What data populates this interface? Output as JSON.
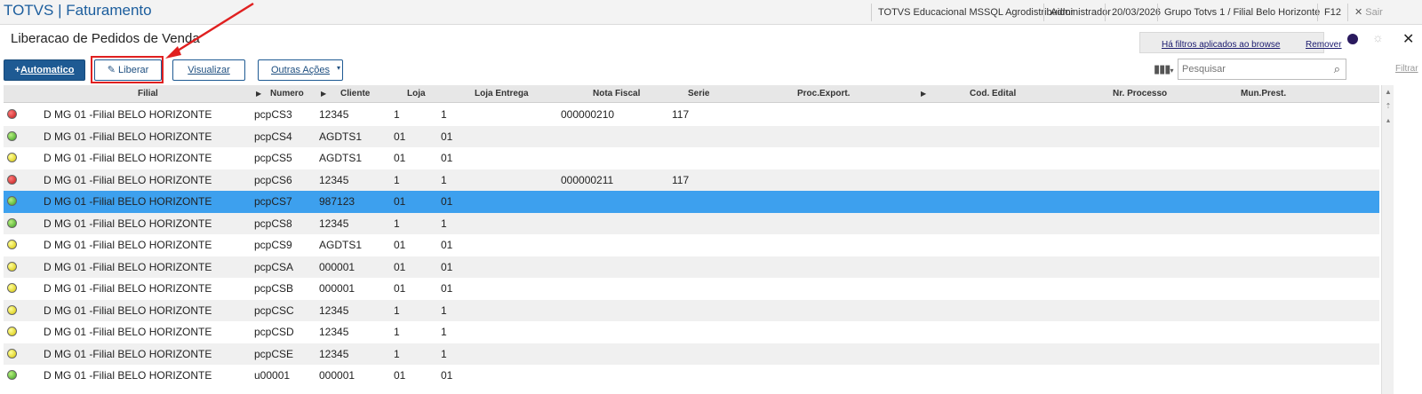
{
  "app": {
    "title": "TOTVS | Faturamento"
  },
  "topbar": {
    "environment": "TOTVS Educacional MSSQL Agrodistribuidor",
    "user": "Administrador",
    "date": "20/03/2026",
    "branch": "Grupo Totvs 1 / Filial Belo Horizonte",
    "f12": "F12",
    "exit": "Sair"
  },
  "page": {
    "title": "Liberacao de Pedidos de Venda"
  },
  "filters": {
    "applied": "Há filtros aplicados ao browse",
    "remove": "Remover"
  },
  "toolbar": {
    "automatico": "Automatico",
    "liberar": "Liberar",
    "visualizar": "Visualizar",
    "outras_acoes": "Outras Ações"
  },
  "search": {
    "placeholder": "Pesquisar",
    "filter_link": "Filtrar"
  },
  "grid": {
    "columns": [
      "Filial",
      "Numero",
      "Cliente",
      "Loja",
      "Loja Entrega",
      "Nota Fiscal",
      "Serie",
      "Proc.Export.",
      "Cod. Edital",
      "Nr. Processo",
      "Mun.Prest."
    ],
    "rows": [
      {
        "status": "red",
        "filial": "D MG 01 -Filial BELO HORIZONTE",
        "numero": "pcpCS3",
        "cliente": "12345",
        "loja": "1",
        "loja_entrega": "1",
        "nota": "000000210",
        "serie": "117"
      },
      {
        "status": "green",
        "filial": "D MG 01 -Filial BELO HORIZONTE",
        "numero": "pcpCS4",
        "cliente": "AGDTS1",
        "loja": "01",
        "loja_entrega": "01",
        "nota": "",
        "serie": ""
      },
      {
        "status": "yellow",
        "filial": "D MG 01 -Filial BELO HORIZONTE",
        "numero": "pcpCS5",
        "cliente": "AGDTS1",
        "loja": "01",
        "loja_entrega": "01",
        "nota": "",
        "serie": ""
      },
      {
        "status": "red",
        "filial": "D MG 01 -Filial BELO HORIZONTE",
        "numero": "pcpCS6",
        "cliente": "12345",
        "loja": "1",
        "loja_entrega": "1",
        "nota": "000000211",
        "serie": "117"
      },
      {
        "status": "green",
        "filial": "D MG 01 -Filial BELO HORIZONTE",
        "numero": "pcpCS7",
        "cliente": "987123",
        "loja": "01",
        "loja_entrega": "01",
        "nota": "",
        "serie": "",
        "selected": true
      },
      {
        "status": "green",
        "filial": "D MG 01 -Filial BELO HORIZONTE",
        "numero": "pcpCS8",
        "cliente": "12345",
        "loja": "1",
        "loja_entrega": "1",
        "nota": "",
        "serie": ""
      },
      {
        "status": "yellow",
        "filial": "D MG 01 -Filial BELO HORIZONTE",
        "numero": "pcpCS9",
        "cliente": "AGDTS1",
        "loja": "01",
        "loja_entrega": "01",
        "nota": "",
        "serie": ""
      },
      {
        "status": "yellow",
        "filial": "D MG 01 -Filial BELO HORIZONTE",
        "numero": "pcpCSA",
        "cliente": "000001",
        "loja": "01",
        "loja_entrega": "01",
        "nota": "",
        "serie": ""
      },
      {
        "status": "yellow",
        "filial": "D MG 01 -Filial BELO HORIZONTE",
        "numero": "pcpCSB",
        "cliente": "000001",
        "loja": "01",
        "loja_entrega": "01",
        "nota": "",
        "serie": ""
      },
      {
        "status": "yellow",
        "filial": "D MG 01 -Filial BELO HORIZONTE",
        "numero": "pcpCSC",
        "cliente": "12345",
        "loja": "1",
        "loja_entrega": "1",
        "nota": "",
        "serie": ""
      },
      {
        "status": "yellow",
        "filial": "D MG 01 -Filial BELO HORIZONTE",
        "numero": "pcpCSD",
        "cliente": "12345",
        "loja": "1",
        "loja_entrega": "1",
        "nota": "",
        "serie": ""
      },
      {
        "status": "yellow",
        "filial": "D MG 01 -Filial BELO HORIZONTE",
        "numero": "pcpCSE",
        "cliente": "12345",
        "loja": "1",
        "loja_entrega": "1",
        "nota": "",
        "serie": ""
      },
      {
        "status": "green",
        "filial": "D MG 01 -Filial BELO HORIZONTE",
        "numero": "u00001",
        "cliente": "000001",
        "loja": "01",
        "loja_entrega": "01",
        "nota": "",
        "serie": ""
      }
    ]
  },
  "colors": {
    "brand": "#1b5d9d",
    "selected_row": "#3da0ee",
    "highlight": "#e02020"
  }
}
